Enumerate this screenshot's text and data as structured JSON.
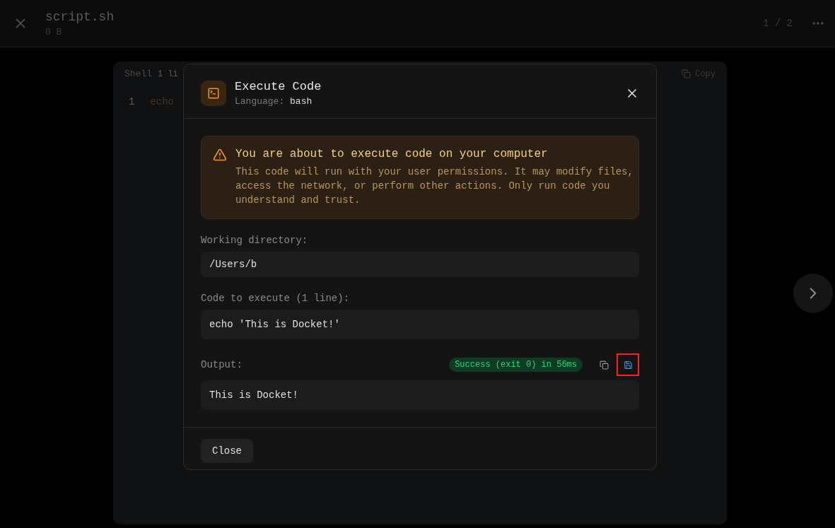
{
  "top_bar": {
    "file_name": "script.sh",
    "file_size": "0 B",
    "pager": "1 / 2"
  },
  "code_panel": {
    "language": "Shell",
    "line_info": "1 li",
    "copy_label": "Copy",
    "lines": [
      {
        "number": "1",
        "code": "echo"
      }
    ]
  },
  "dialog": {
    "title": "Execute Code",
    "language_label": "Language:",
    "language": "bash",
    "warning": {
      "title": "You are about to execute code on your computer",
      "body": "This code will run with your user permissions. It may modify files, access the network, or perform other actions. Only run code you understand and trust."
    },
    "working_directory": {
      "label": "Working directory:",
      "value": "/Users/b"
    },
    "code": {
      "label": "Code to execute (1 line):",
      "value": "echo 'This is Docket!'"
    },
    "output": {
      "label": "Output:",
      "status": "Success (exit 0) in 56ms",
      "save_highlighted": true,
      "value": "This is Docket!"
    },
    "buttons": [
      "Close"
    ]
  }
}
